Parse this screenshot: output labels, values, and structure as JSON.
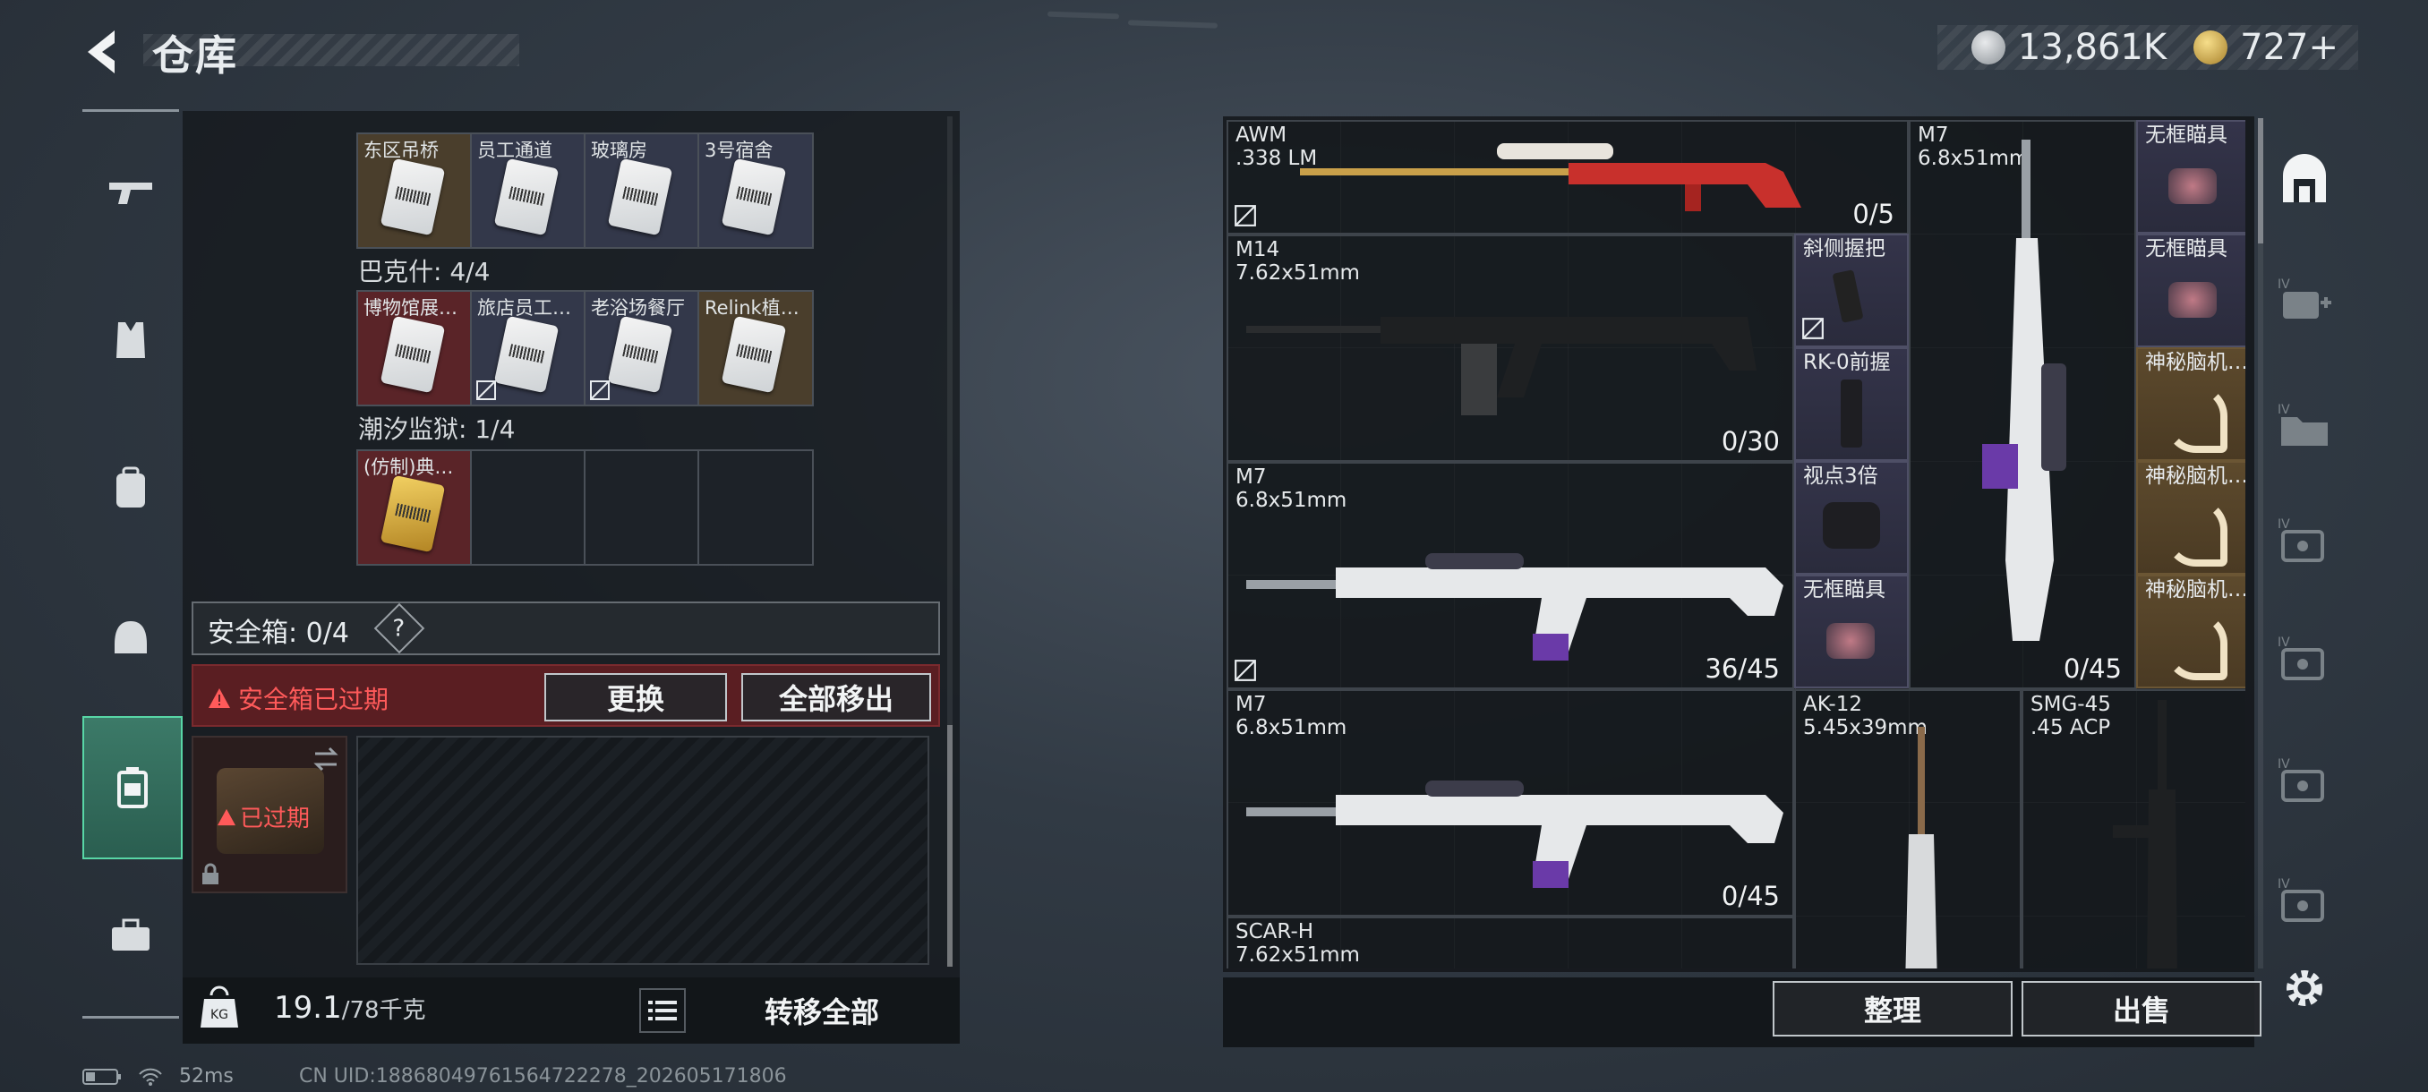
{
  "header": {
    "title": "仓库"
  },
  "currency": {
    "primary": "13,861K",
    "secondary": "727+"
  },
  "left_rail": {
    "items": [
      "gun-icon",
      "armor-vest-icon",
      "backpack-icon",
      "helmet-icon",
      "container-icon",
      "toolbox-icon"
    ]
  },
  "inventory": {
    "group_top_partial": "",
    "row1": [
      "东区吊桥",
      "员工通道",
      "玻璃房",
      "3号宿舍"
    ],
    "group_bakeshi": "巴克什: 4/4",
    "row2": [
      "博物馆展…",
      "旅店员工…",
      "老浴场餐厅",
      "Relink植…"
    ],
    "group_chaoxi": "潮汐监狱: 1/4",
    "row3": [
      "(仿制)典…"
    ]
  },
  "safebox": {
    "label": "安全箱: 0/4",
    "help": "?",
    "expired_warning": "安全箱已过期",
    "replace_button": "更换",
    "remove_all_button": "全部移出",
    "item_status": "已过期"
  },
  "weight": {
    "current": "19.1",
    "max": "/78千克"
  },
  "transfer_all_button": "转移全部",
  "weapons": [
    {
      "name": "AWM",
      "caliber": ".338 LM",
      "count": "0/5"
    },
    {
      "name": "M7",
      "caliber": "6.8x51mm",
      "count": "0/45"
    },
    {
      "name": "M14",
      "caliber": "7.62x51mm",
      "count": "0/30"
    },
    {
      "name": "M7",
      "caliber": "6.8x51mm",
      "count": "36/45"
    },
    {
      "name": "M7",
      "caliber": "6.8x51mm",
      "count": "0/45"
    },
    {
      "name": "AK-12",
      "caliber": "5.45x39mm",
      "count": ""
    },
    {
      "name": "SMG-45",
      "caliber": ".45 ACP",
      "count": ""
    },
    {
      "name": "SCAR-H",
      "caliber": "7.62x51mm",
      "count": ""
    }
  ],
  "attachments": [
    "斜侧握把",
    "RK-0前握",
    "视点3倍",
    "无框瞄具"
  ],
  "right_column": [
    "无框瞄具",
    "无框瞄具",
    "神秘脑机…",
    "神秘脑机…",
    "神秘脑机…"
  ],
  "bottom_buttons": {
    "sort": "整理",
    "sell": "出售"
  },
  "right_rail_labels": [
    "IV",
    "IV",
    "IV",
    "IV",
    "IV",
    "IV"
  ],
  "status_bar": {
    "ping": "52ms",
    "uid": "CN UID:18868049761564722278_202605171806"
  },
  "colors": {
    "accent_green": "#58d6a6",
    "warning_red": "#ff5a5a",
    "purple_rarity": "#34344a",
    "gold_rarity": "#5d4a2d",
    "red_rarity": "#5a2428"
  }
}
